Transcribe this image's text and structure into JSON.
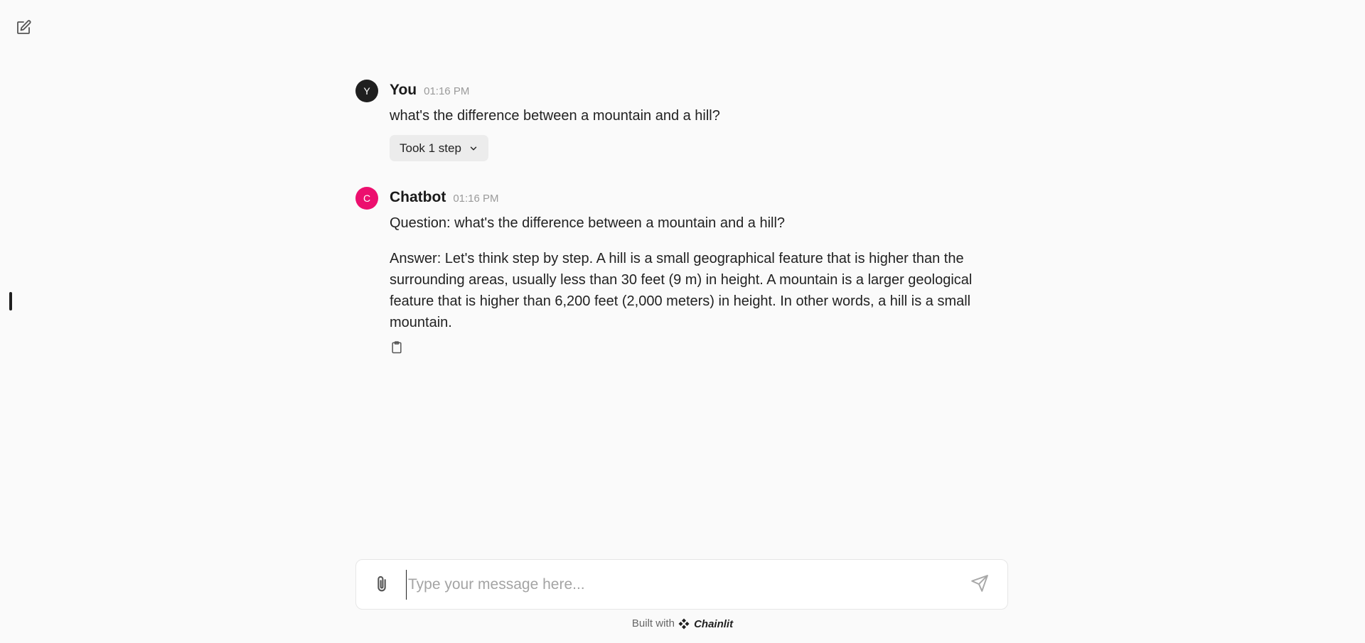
{
  "header": {
    "new_chat_icon": "pencil-square-icon"
  },
  "messages": [
    {
      "avatar_letter": "Y",
      "author": "You",
      "time": "01:16 PM",
      "text": "what's the difference between a mountain and a hill?",
      "step_label": "Took 1 step"
    },
    {
      "avatar_letter": "C",
      "author": "Chatbot",
      "time": "01:16 PM",
      "paragraph_1": "Question: what's the difference between a mountain and a hill?",
      "paragraph_2": "Answer: Let's think step by step. A hill is a small geographical feature that is higher than the surrounding areas, usually less than 30 feet (9 m) in height. A mountain is a larger geological feature that is higher than 6,200 feet (2,000 meters) in height. In other words, a hill is a small mountain."
    }
  ],
  "composer": {
    "placeholder": "Type your message here...",
    "value": ""
  },
  "footer": {
    "built_with": "Built with",
    "brand": "Chainlit"
  },
  "colors": {
    "user_avatar": "#1f1f1f",
    "bot_avatar": "#ec0f6e",
    "background": "#fafafa"
  }
}
